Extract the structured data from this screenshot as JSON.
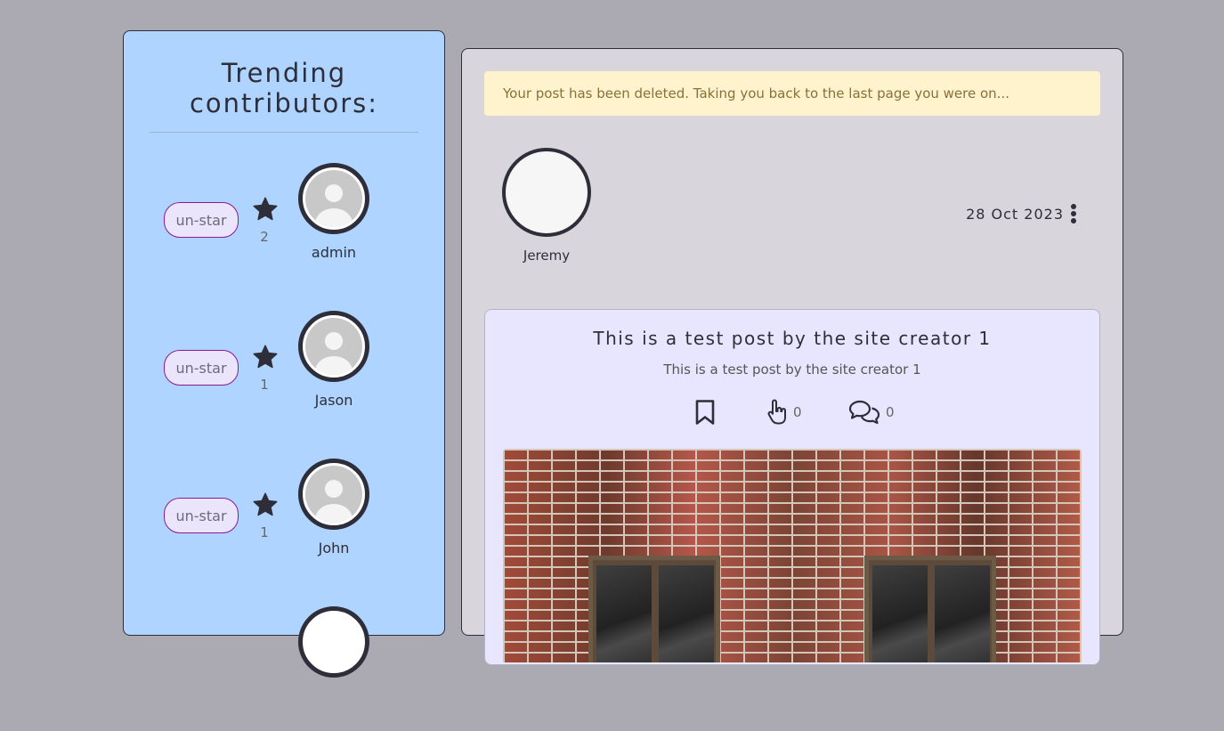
{
  "sidebar": {
    "title": "Trending contributors:",
    "contributors": [
      {
        "name": "admin",
        "stars": "2",
        "button_label": "un-star"
      },
      {
        "name": "Jason",
        "stars": "1",
        "button_label": "un-star"
      },
      {
        "name": "John",
        "stars": "1",
        "button_label": "un-star"
      }
    ]
  },
  "alert": {
    "message": "Your post has been deleted. Taking you back to the last page you were on..."
  },
  "post": {
    "author": "Jeremy",
    "date": "28 Oct 2023",
    "title": "This is a test post by the site creator 1",
    "body": "This is a test post by the site creator 1",
    "likes": "0",
    "comments": "0",
    "icons": {
      "bookmark": "bookmark-icon",
      "like": "pointing-hand-icon",
      "comments": "speech-bubbles-icon",
      "options": "kebab-menu-icon",
      "star": "star-icon"
    }
  },
  "colors": {
    "page_background": "#abaab2",
    "sidebar_background": "#aed4ff",
    "main_background": "#d8d6dc",
    "card_background": "#e7e6fe",
    "alert_background": "#fff3cd",
    "alert_text": "#8a7039",
    "button_border": "#8b1a9a",
    "dark": "#2e2e3a"
  }
}
